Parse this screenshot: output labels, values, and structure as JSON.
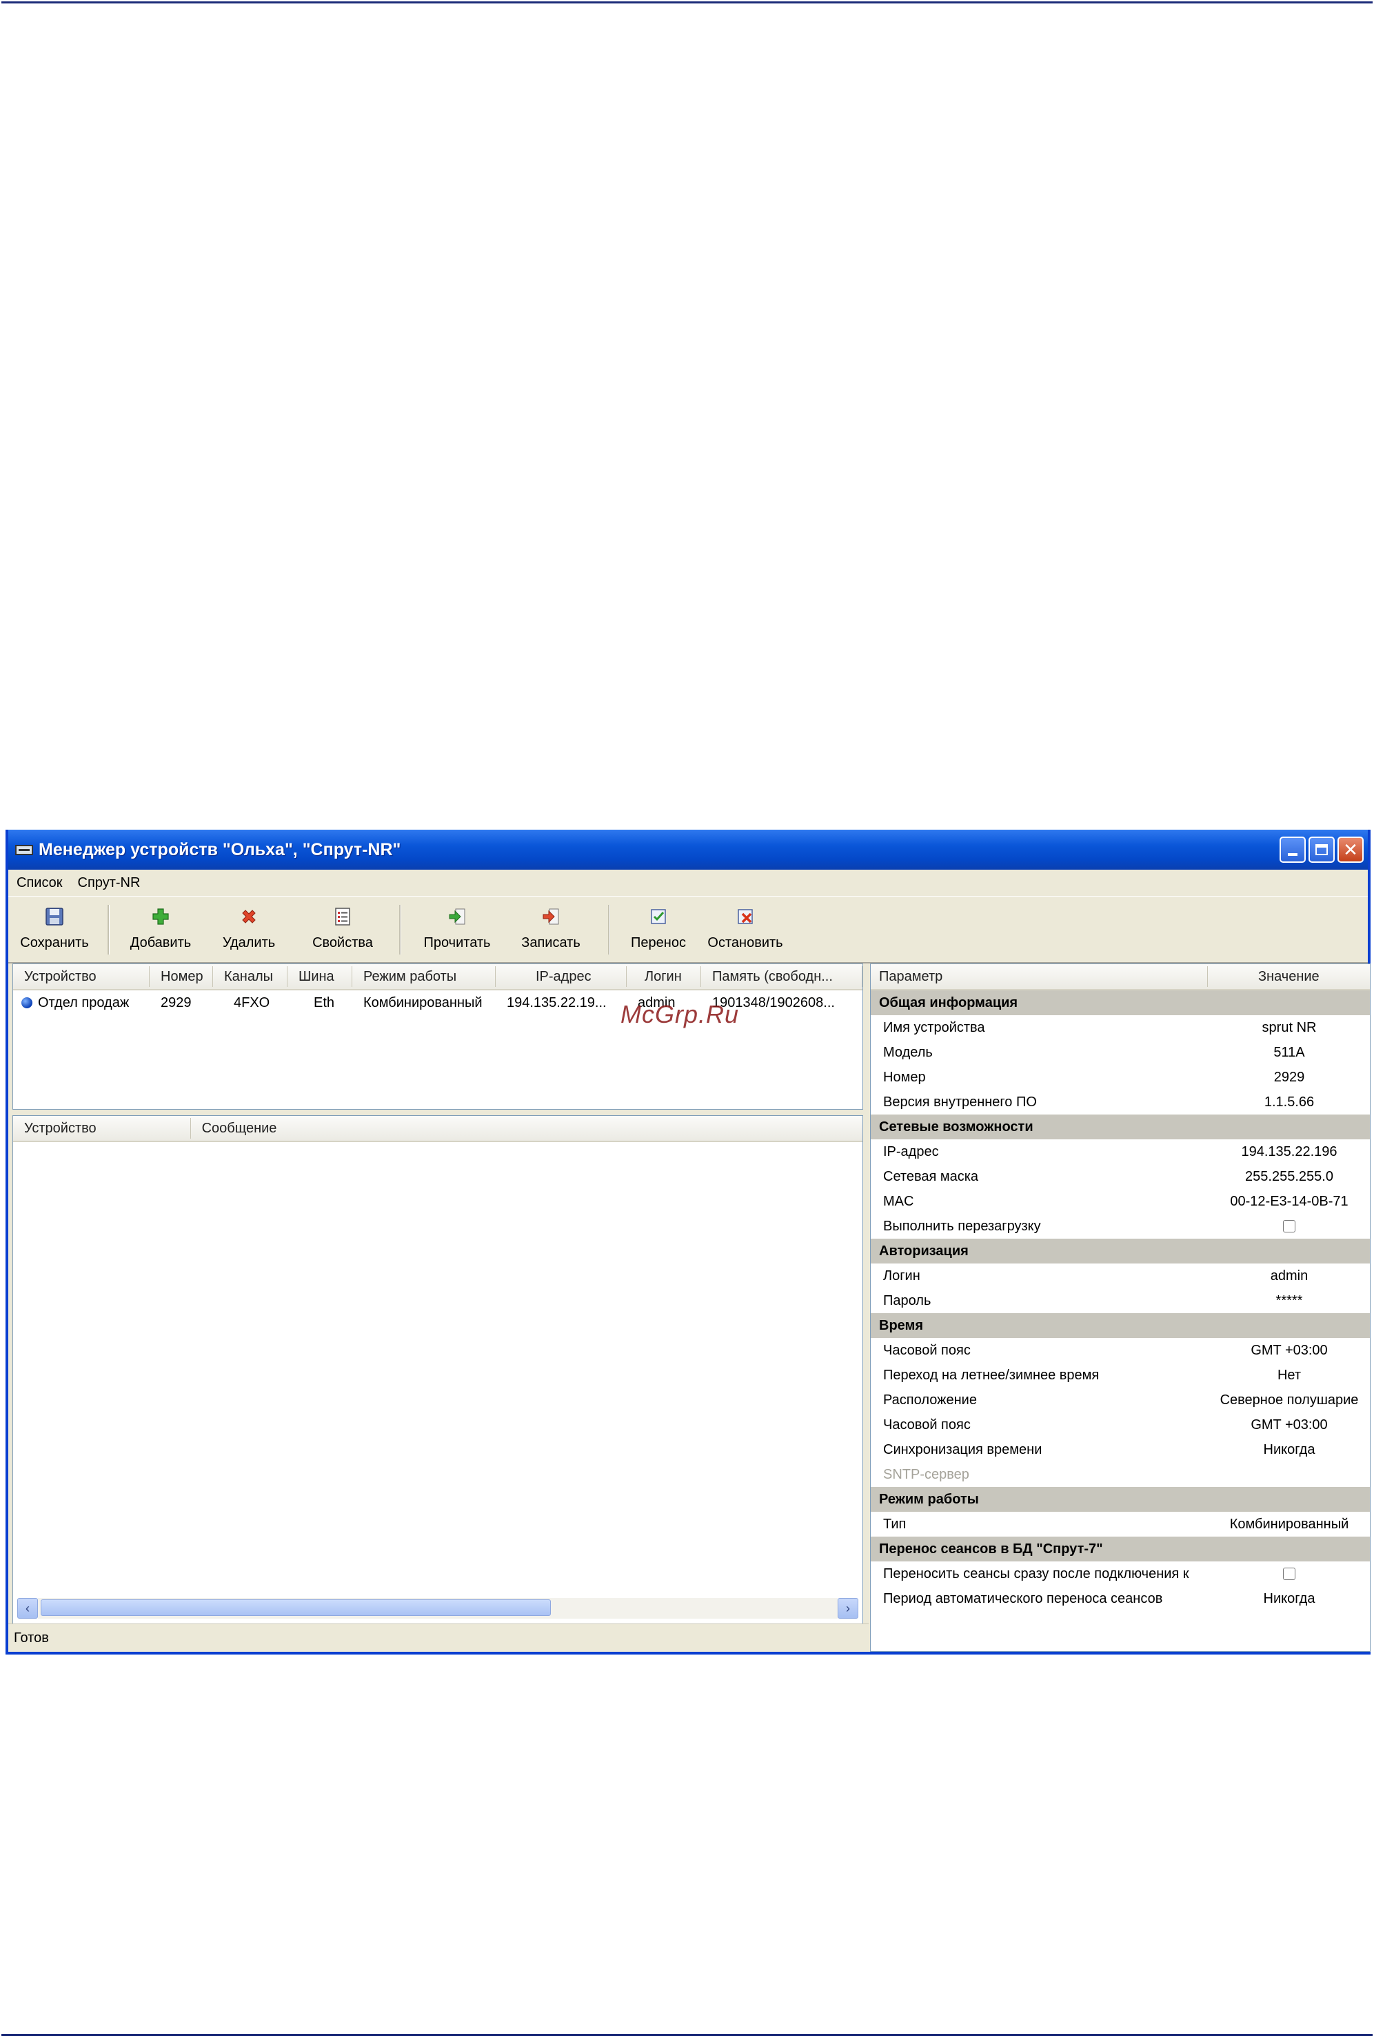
{
  "watermark": "McGrp.Ru",
  "window": {
    "title": "Менеджер устройств \"Ольха\", \"Спрут-NR\"",
    "buttons": {
      "minimize": "minimize-icon",
      "maximize": "maximize-icon",
      "close": "✕"
    }
  },
  "menu": [
    "Список",
    "Спрут-NR"
  ],
  "toolbar": [
    {
      "label": "Сохранить",
      "icon": "floppy-icon"
    },
    {
      "label": "Добавить",
      "icon": "plus-icon"
    },
    {
      "label": "Удалить",
      "icon": "delete-x-icon"
    },
    {
      "label": "Свойства",
      "icon": "properties-icon"
    },
    {
      "label": "Прочитать",
      "icon": "read-arrow-icon"
    },
    {
      "label": "Записать",
      "icon": "write-arrow-icon"
    },
    {
      "label": "Перенос",
      "icon": "transfer-icon"
    },
    {
      "label": "Остановить",
      "icon": "stop-icon"
    }
  ],
  "devices": {
    "columns": [
      "Устройство",
      "Номер",
      "Каналы",
      "Шина",
      "Режим работы",
      "IP-адрес",
      "Логин",
      "Память (свободн..."
    ],
    "rows": [
      [
        "Отдел продаж",
        "2929",
        "4FXO",
        "Eth",
        "Комбинированный",
        "194.135.22.19...",
        "admin",
        "1901348/1902608..."
      ]
    ]
  },
  "log": {
    "columns": [
      "Устройство",
      "Сообщение"
    ]
  },
  "status": "Готов",
  "properties": {
    "columns": [
      "Параметр",
      "Значение"
    ],
    "sections": [
      {
        "title": "Общая информация",
        "rows": [
          {
            "name": "Имя устройства",
            "value": "sprut NR"
          },
          {
            "name": "Модель",
            "value": "511A"
          },
          {
            "name": "Номер",
            "value": "2929"
          },
          {
            "name": "Версия внутреннего ПО",
            "value": "1.1.5.66"
          }
        ]
      },
      {
        "title": "Сетевые возможности",
        "rows": [
          {
            "name": "IP-адрес",
            "value": "194.135.22.196"
          },
          {
            "name": "Сетевая маска",
            "value": "255.255.255.0"
          },
          {
            "name": "MAC",
            "value": "00-12-E3-14-0B-71"
          },
          {
            "name": "Выполнить перезагрузку",
            "value": "",
            "checkbox": true
          }
        ]
      },
      {
        "title": "Авторизация",
        "rows": [
          {
            "name": "Логин",
            "value": "admin"
          },
          {
            "name": "Пароль",
            "value": "*****"
          }
        ]
      },
      {
        "title": "Время",
        "rows": [
          {
            "name": "Часовой пояс",
            "value": "GMT +03:00"
          },
          {
            "name": "Переход на летнее/зимнее время",
            "value": "Нет"
          },
          {
            "name": "Расположение",
            "value": "Северное полушарие"
          },
          {
            "name": "Часовой пояс",
            "value": "GMT +03:00"
          },
          {
            "name": "Синхронизация времени",
            "value": "Никогда"
          },
          {
            "name": "SNTP-сервер",
            "value": "",
            "disabled": true
          }
        ]
      },
      {
        "title": "Режим работы",
        "rows": [
          {
            "name": "Тип",
            "value": "Комбинированный"
          }
        ]
      },
      {
        "title": "Перенос сеансов в БД \"Спрут-7\"",
        "rows": [
          {
            "name": "Переносить сеансы сразу после подключения к",
            "value": "",
            "checkbox": true
          },
          {
            "name": "Период автоматического переноса сеансов",
            "value": "Никогда"
          }
        ]
      }
    ]
  }
}
